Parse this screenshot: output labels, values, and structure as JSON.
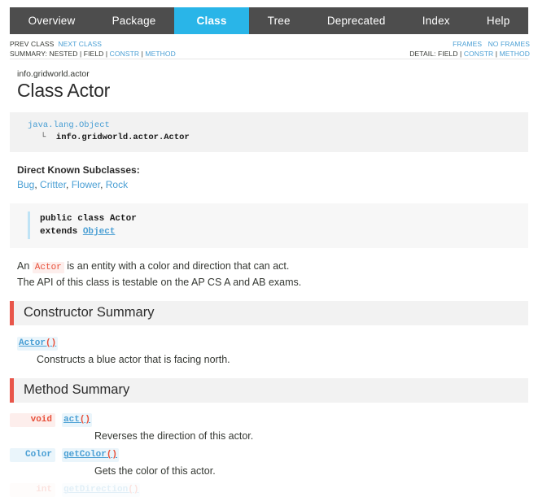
{
  "topnav": {
    "tabs": [
      {
        "label": "Overview",
        "active": false
      },
      {
        "label": "Package",
        "active": false
      },
      {
        "label": "Class",
        "active": true
      },
      {
        "label": "Tree",
        "active": false
      },
      {
        "label": "Deprecated",
        "active": false
      },
      {
        "label": "Index",
        "active": false
      },
      {
        "label": "Help",
        "active": false
      }
    ],
    "active_tab": "Class",
    "background_color": "#4d4d4d",
    "active_color": "#29b5e8"
  },
  "subnav": {
    "prev_class": "PREV CLASS",
    "next_class": "NEXT CLASS",
    "summary_label": "SUMMARY:",
    "summary_items": [
      "NESTED",
      "FIELD",
      "CONSTR",
      "METHOD"
    ],
    "frames": "FRAMES",
    "no_frames": "NO FRAMES",
    "detail_label": "DETAIL:",
    "detail_items": [
      "FIELD",
      "CONSTR",
      "METHOD"
    ],
    "separator": "|"
  },
  "header": {
    "package": "info.gridworld.actor",
    "title": "Class Actor"
  },
  "inheritance": {
    "root": "java.lang.Object",
    "branch_glyph": "└",
    "child": "info.gridworld.actor.Actor"
  },
  "subclasses": {
    "label": "Direct Known Subclasses:",
    "items": [
      "Bug",
      "Critter",
      "Flower",
      "Rock"
    ],
    "separator": ", "
  },
  "declaration": {
    "line1": "public class Actor",
    "extends_keyword": "extends",
    "extends_type": "Object"
  },
  "description": {
    "line1_prefix": "An",
    "line1_code": "Actor",
    "line1_suffix": "is an entity with a color and direction that can act.",
    "line2": "The API of this class is testable on the AP CS A and AB exams."
  },
  "constructor_summary": {
    "heading": "Constructor Summary",
    "entries": [
      {
        "name": "Actor",
        "parens": "()",
        "description": "Constructs a blue actor that is facing north."
      }
    ]
  },
  "method_summary": {
    "heading": "Method Summary",
    "entries": [
      {
        "return_type": "void",
        "return_kind": "void",
        "name": "act",
        "parens": "()",
        "description": "Reverses the direction of this actor."
      },
      {
        "return_type": "Color",
        "return_kind": "type",
        "name": "getColor",
        "parens": "()",
        "description": "Gets the color of this actor."
      },
      {
        "return_type": "int",
        "return_kind": "void",
        "name": "getDirection",
        "parens": "()",
        "description": ""
      }
    ]
  },
  "colors": {
    "link": "#4a9fd4",
    "accent_red": "#e8564a",
    "nav_active": "#29b5e8",
    "nav_bg": "#4d4d4d",
    "panel_bg": "#f2f2f2"
  }
}
